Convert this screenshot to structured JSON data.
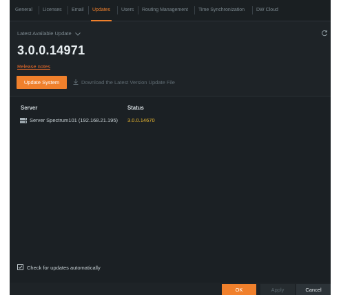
{
  "tabs": [
    {
      "label": "General",
      "active": false
    },
    {
      "label": "Licenses",
      "active": false
    },
    {
      "label": "Email",
      "active": false
    },
    {
      "label": "Updates",
      "active": true
    },
    {
      "label": "Users",
      "active": false
    },
    {
      "label": "Routing Management",
      "active": false
    },
    {
      "label": "Time Synchronization",
      "active": false
    },
    {
      "label": "DW Cloud",
      "active": false
    }
  ],
  "update": {
    "latest_label": "Latest Available Update",
    "version": "3.0.0.14971",
    "release_notes": "Release notes",
    "update_button": "Update System",
    "download_link": "Download the Latest Version Update File"
  },
  "table": {
    "headers": {
      "server": "Server",
      "status": "Status"
    },
    "rows": [
      {
        "server": "Server Spectrum101 (192.168.21.195)",
        "status": "3.0.0.14670"
      }
    ]
  },
  "auto_check": {
    "label": "Check for updates automatically",
    "checked": true
  },
  "footer": {
    "ok": "OK",
    "apply": "Apply",
    "cancel": "Cancel"
  },
  "colors": {
    "accent": "#f0802c",
    "status_value": "#e9b730",
    "background": "#1e2327"
  }
}
